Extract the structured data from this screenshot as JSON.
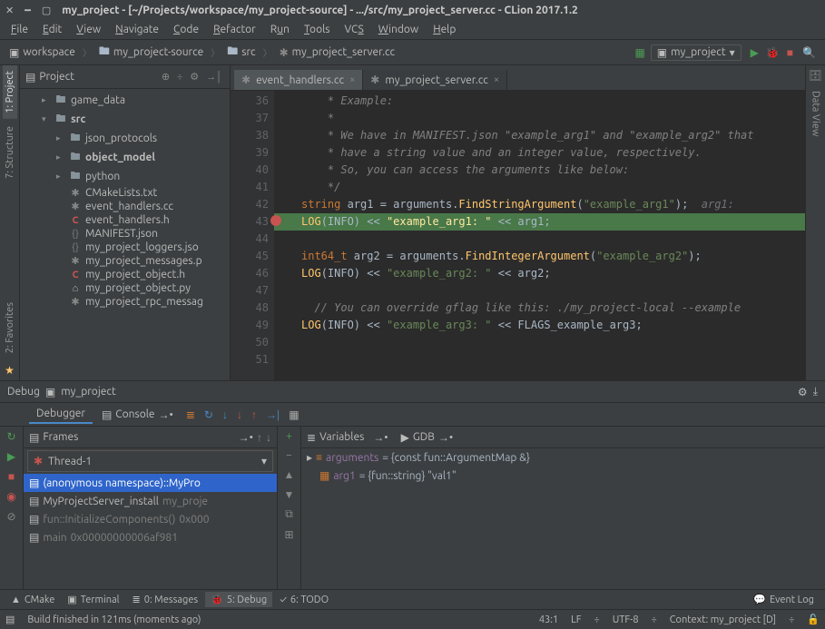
{
  "window": {
    "title": "my_project - [~/Projects/workspace/my_project-source] - .../src/my_project_server.cc - CLion 2017.1.2"
  },
  "menu": {
    "file": "File",
    "edit": "Edit",
    "view": "View",
    "navigate": "Navigate",
    "code": "Code",
    "refactor": "Refactor",
    "run": "Run",
    "tools": "Tools",
    "vcs": "VCS",
    "window": "Window",
    "help": "Help"
  },
  "breadcrumbs": {
    "root": "workspace",
    "parts": [
      "my_project-source",
      "src",
      "my_project_server.cc"
    ]
  },
  "run_config": "my_project",
  "project_panel": {
    "title": "Project",
    "tree": {
      "game_data": "game_data",
      "src": "src",
      "json_protocols": "json_protocols",
      "object_model": "object_model",
      "python": "python",
      "cmake": "CMakeLists.txt",
      "ev_cc": "event_handlers.cc",
      "ev_h": "event_handlers.h",
      "manifest": "MANIFEST.json",
      "loggers": "my_project_loggers.jso",
      "messages": "my_project_messages.p",
      "obj_h": "my_project_object.h",
      "obj_py": "my_project_object.py",
      "rpc": "my_project_rpc_messag"
    }
  },
  "side_tools": {
    "project": "1: Project",
    "structure": "7: Structure",
    "favorites": "2: Favorites",
    "dataview": "Data View"
  },
  "tabs": {
    "t0": "event_handlers.cc",
    "t1": "my_project_server.cc"
  },
  "code": {
    "lines": [
      "36",
      "37",
      "38",
      "39",
      "40",
      "41",
      "42",
      "43",
      "44",
      "45",
      "46",
      "47",
      "48",
      "49",
      "50",
      "51"
    ],
    "l36": "    * Example:",
    "l37": "    *",
    "l38": "    * We have in MANIFEST.json \"example_arg1\" and \"example_arg2\" that ",
    "l39": "    * have a string value and an integer value, respectively.",
    "l40": "    * So, you can access the arguments like below:",
    "l41": "    */",
    "l42a": "string ",
    "l42b": "arg1 = arguments.",
    "l42c": "FindStringArgument",
    "l42d": "(",
    "l42e": "\"example_arg1\"",
    "l42f": ");",
    "l42g": "  arg1:",
    "l43a": "LOG",
    "l43b": "(INFO) << ",
    "l43c": "\"example_arg1: \"",
    "l43d": " << arg1;",
    "l45a": "int64_t ",
    "l45b": "arg2 = arguments.",
    "l45c": "FindIntegerArgument",
    "l45d": "(",
    "l45e": "\"example_arg2\"",
    "l45f": ");",
    "l46a": "LOG",
    "l46b": "(INFO) << ",
    "l46c": "\"example_arg2: \"",
    "l46d": " << arg2;",
    "l48": "  // You can override gflag like this: ./my_project-local --example",
    "l49a": "LOG",
    "l49b": "(INFO) << ",
    "l49c": "\"example_arg3: \"",
    "l49d": " << FLAGS_example_arg3;"
  },
  "debug": {
    "title": "Debug",
    "config": "my_project",
    "tabs": {
      "debugger": "Debugger",
      "console": "Console"
    },
    "panes": {
      "frames": "Frames",
      "variables": "Variables",
      "gdb": "GDB"
    },
    "thread": "Thread-1",
    "frames": {
      "f0": "(anonymous namespace)::MyPro",
      "f1a": "MyProjectServer_install",
      "f1b": "my_proje",
      "f2a": "fun::InitializeComponents()",
      "f2b": "0x000",
      "f3a": "main",
      "f3b": "0x00000000006af981"
    },
    "vars": {
      "v0_name": "arguments",
      "v0_val": "= {const fun::ArgumentMap &}",
      "v1_name": "arg1",
      "v1_val": "= {fun::string} \"val1\""
    }
  },
  "bottom_tabs": {
    "cmake": "CMake",
    "terminal": "Terminal",
    "messages": "0: Messages",
    "debug": "5: Debug",
    "todo": "6: TODO",
    "eventlog": "Event Log"
  },
  "status": {
    "build": "Build finished in 121ms (moments ago)",
    "pos": "43:1",
    "lf": "LF",
    "enc": "UTF-8",
    "context": "Context: my_project [D]"
  }
}
